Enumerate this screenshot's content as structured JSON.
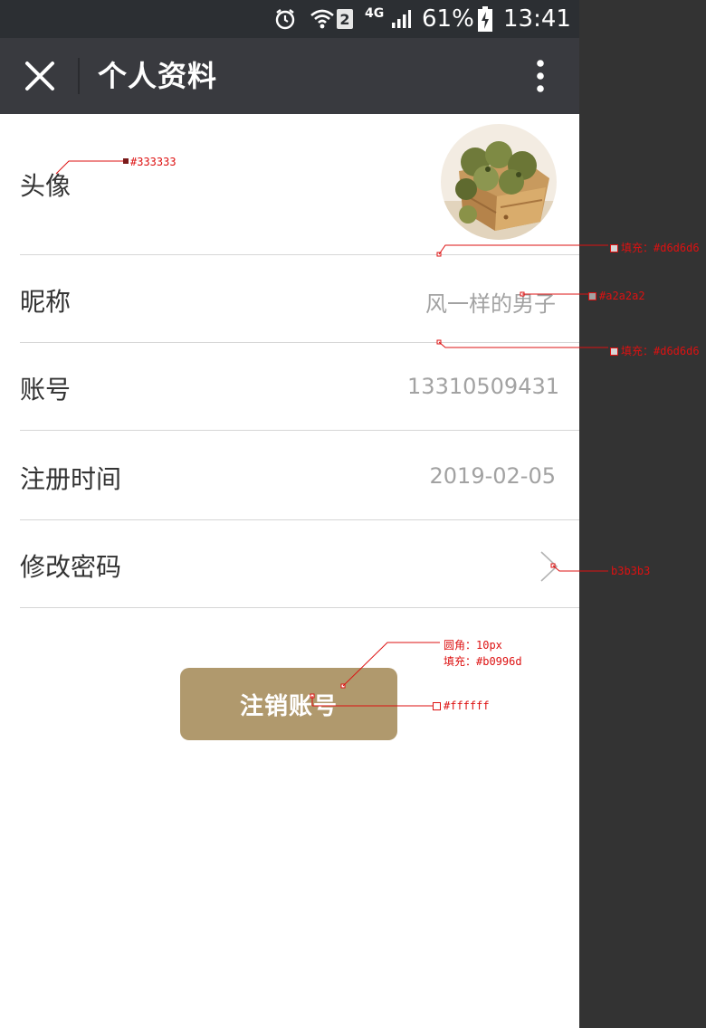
{
  "status_bar": {
    "network": "4G",
    "sim_slot": "2",
    "battery_percent": "61%",
    "time": "13:41"
  },
  "title_bar": {
    "title": "个人资料"
  },
  "profile": {
    "avatar_label": "头像",
    "nickname_label": "昵称",
    "nickname_value": "风一样的男子",
    "account_label": "账号",
    "account_value": "13310509431",
    "register_label": "注册时间",
    "register_value": "2019-02-05",
    "password_label": "修改密码"
  },
  "actions": {
    "logout_label": "注销账号"
  },
  "annotations": {
    "label_color": "#333333",
    "divider_fill_1": "填充：#d6d6d6",
    "value_color": "#a2a2a2",
    "divider_fill_2": "填充：#d6d6d6",
    "chevron_color": "b3b3b3",
    "button_radius": "圆角：10px",
    "button_fill": "填充：#b0996d",
    "button_text_color": "#ffffff"
  },
  "colors": {
    "accent": "#b0996d",
    "label_text": "#333333",
    "value_text": "#a2a2a2",
    "divider": "#d6d6d6",
    "chevron": "#b3b3b3",
    "title_bar_bg": "#393a3f",
    "status_bar_bg": "#2c2f33"
  }
}
